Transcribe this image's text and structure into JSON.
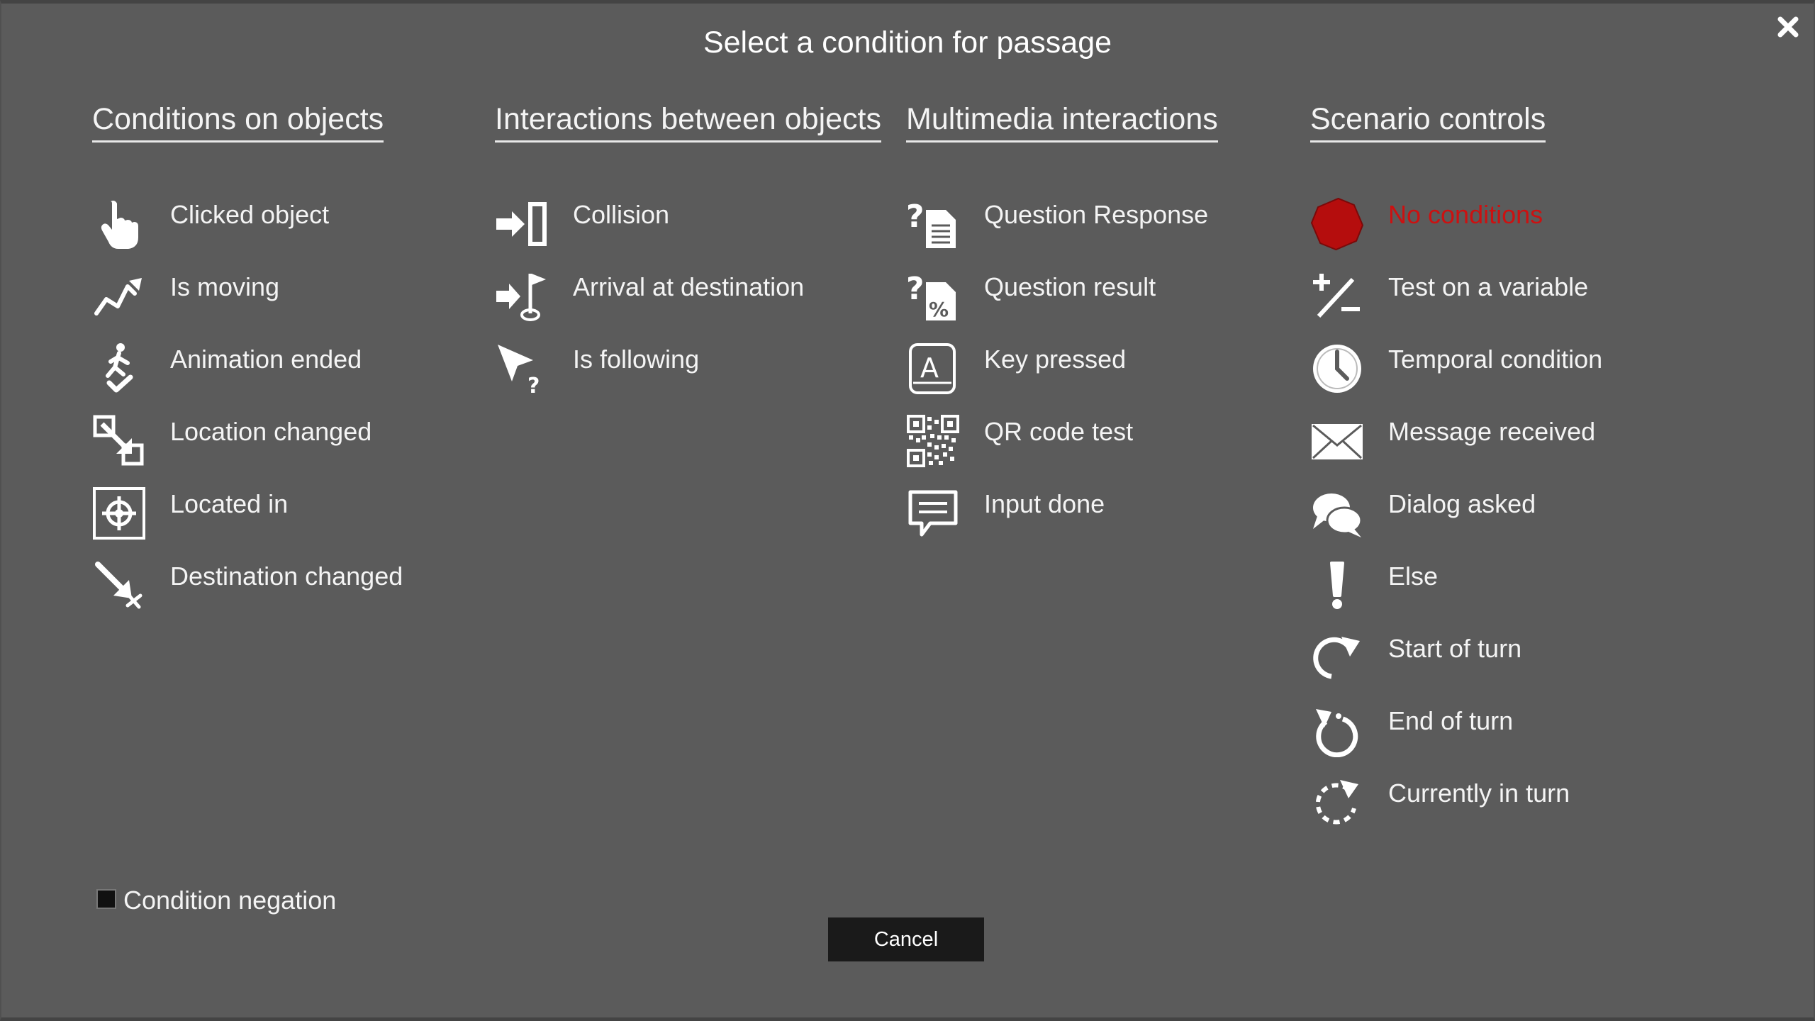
{
  "dialog": {
    "title": "Select a condition for passage",
    "cancel_label": "Cancel",
    "negation_label": "Condition negation",
    "negation_checked": false,
    "accent_color": "#cc1111"
  },
  "columns": [
    {
      "heading": "Conditions on objects",
      "items": [
        {
          "label": "Clicked object",
          "icon": "pointing-hand-icon"
        },
        {
          "label": "Is moving",
          "icon": "moving-path-icon"
        },
        {
          "label": "Animation ended",
          "icon": "walking-figure-icon"
        },
        {
          "label": "Location changed",
          "icon": "location-swap-icon"
        },
        {
          "label": "Located in",
          "icon": "crosshair-box-icon"
        },
        {
          "label": "Destination changed",
          "icon": "destination-arrow-icon"
        }
      ]
    },
    {
      "heading": "Interactions between objects",
      "items": [
        {
          "label": "Collision",
          "icon": "collision-arrow-icon"
        },
        {
          "label": "Arrival at destination",
          "icon": "arrival-flag-icon"
        },
        {
          "label": "Is following",
          "icon": "cursor-question-icon"
        }
      ]
    },
    {
      "heading": "Multimedia interactions",
      "items": [
        {
          "label": "Question Response",
          "icon": "question-document-icon"
        },
        {
          "label": "Question result",
          "icon": "question-percent-icon"
        },
        {
          "label": "Key pressed",
          "icon": "keyboard-key-icon"
        },
        {
          "label": "QR code test",
          "icon": "qr-code-icon"
        },
        {
          "label": "Input done",
          "icon": "speech-bubble-icon"
        }
      ]
    },
    {
      "heading": "Scenario controls",
      "items": [
        {
          "label": "No conditions",
          "icon": "red-octagon-icon",
          "active": true
        },
        {
          "label": "Test on a variable",
          "icon": "plus-minus-icon"
        },
        {
          "label": "Temporal condition",
          "icon": "clock-icon"
        },
        {
          "label": "Message received",
          "icon": "envelope-icon"
        },
        {
          "label": "Dialog asked",
          "icon": "chat-bubbles-icon"
        },
        {
          "label": "Else",
          "icon": "exclamation-icon"
        },
        {
          "label": "Start of turn",
          "icon": "rotate-clockwise-icon"
        },
        {
          "label": "End of turn",
          "icon": "rotate-counterclockwise-icon"
        },
        {
          "label": "Currently in turn",
          "icon": "dashed-rotate-icon"
        }
      ]
    }
  ]
}
